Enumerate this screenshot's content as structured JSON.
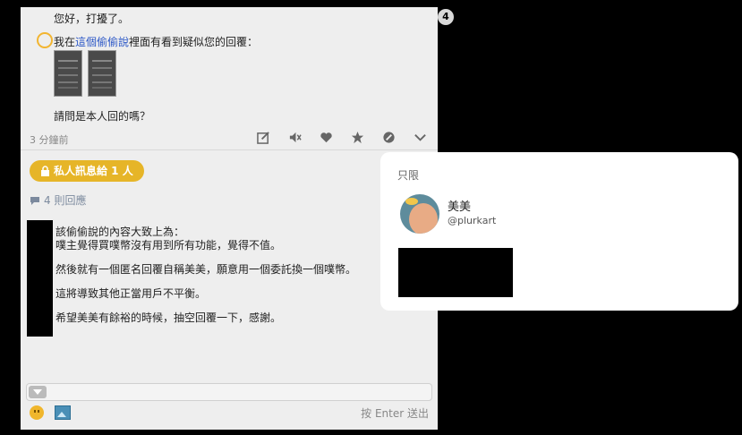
{
  "notification_count": "4",
  "message": {
    "greeting": "您好，打擾了。",
    "line1_prefix": "我在",
    "line1_link": "這個偷偷說",
    "line1_suffix": "裡面有看到疑似您的回覆：",
    "question": "請問是本人回的嗎？",
    "time": "3 分鐘前"
  },
  "actions": [
    "edit-icon",
    "mute-icon",
    "heart-icon",
    "star-icon",
    "block-icon",
    "chevron-down-icon"
  ],
  "private_badge": "私人訊息給 1 人",
  "replies_count": "4 則回應",
  "reply_lines": [
    "該偷偷說的內容大致上為：",
    "噗主覺得買噗幣沒有用到所有功能，覺得不值。",
    "然後就有一個匿名回覆自稱美美，願意用一個委託換一個噗幣。",
    "這將導致其他正當用戶不平衡。",
    "希望美美有餘裕的時候，抽空回覆一下，感謝。"
  ],
  "input": {
    "enter_hint": "按 Enter 送出"
  },
  "popup": {
    "title": "只限",
    "user_name": "美美",
    "user_handle": "@plurkart"
  },
  "colors": {
    "badge": "#e6b528",
    "link": "#2a56c6",
    "panel": "#eeeeee"
  }
}
